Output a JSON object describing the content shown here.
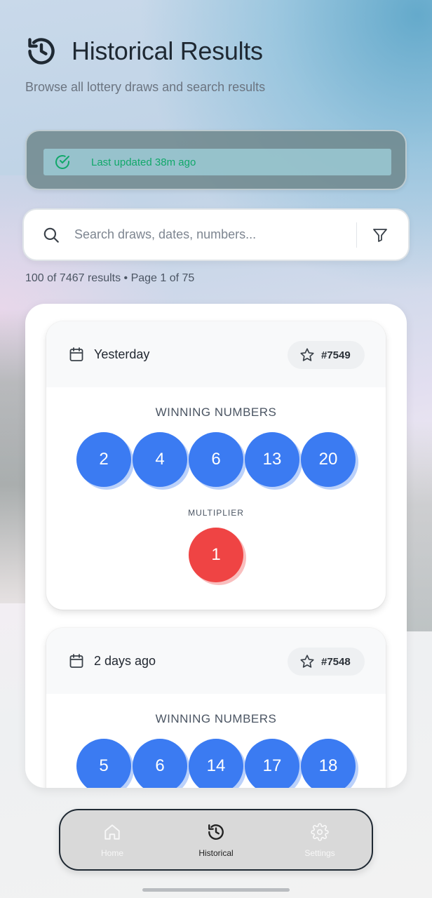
{
  "header": {
    "icon": "history-icon",
    "title": "Historical Results",
    "subtitle": "Browse all lottery draws and search results"
  },
  "status": {
    "icon": "check-circle-icon",
    "text": "Last updated 38m ago",
    "color": "#11a86a"
  },
  "search": {
    "placeholder": "Search draws, dates, numbers...",
    "value": "",
    "filter_icon": "filter-icon"
  },
  "results_summary": "100 of 7467 results • Page 1 of 75",
  "draws": [
    {
      "date": "Yesterday",
      "number": "#7549",
      "winning_label": "WINNING NUMBERS",
      "numbers": [
        "2",
        "4",
        "6",
        "13",
        "20"
      ],
      "multiplier_label": "MULTIPLIER",
      "multiplier": "1"
    },
    {
      "date": "2 days ago",
      "number": "#7548",
      "winning_label": "WINNING NUMBERS",
      "numbers": [
        "5",
        "6",
        "14",
        "17",
        "18"
      ]
    }
  ],
  "colors": {
    "ball_blue": "#3b7bf2",
    "ball_red": "#ef4444"
  },
  "nav": {
    "items": [
      {
        "label": "Home",
        "icon": "home-icon",
        "active": false
      },
      {
        "label": "Historical",
        "icon": "history-icon",
        "active": true
      },
      {
        "label": "Settings",
        "icon": "gear-icon",
        "active": false
      }
    ]
  }
}
